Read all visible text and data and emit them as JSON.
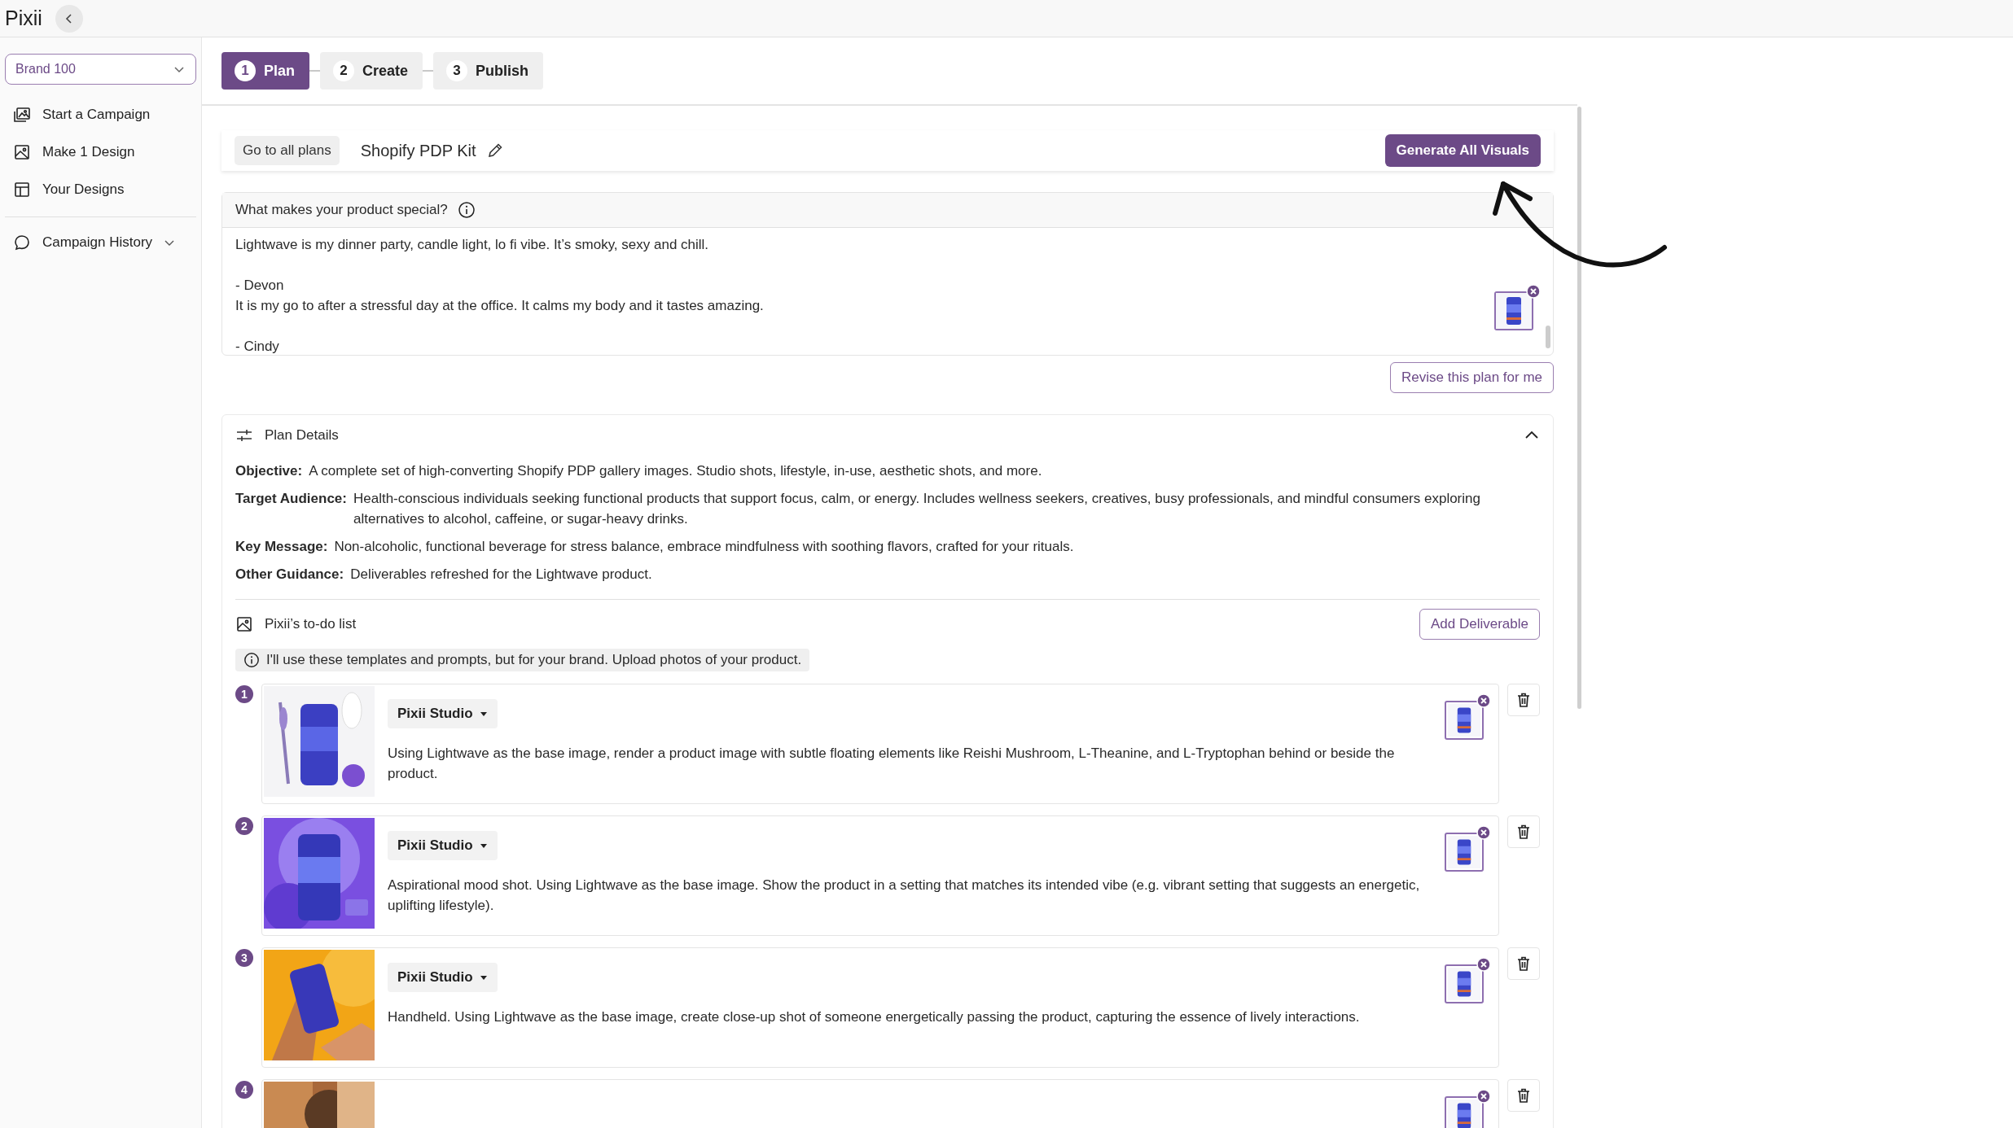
{
  "app": {
    "logo": "Pixii"
  },
  "sidebar": {
    "brand_select": "Brand 100",
    "items": [
      {
        "label": "Start a Campaign",
        "kind": "campaign"
      },
      {
        "label": "Make 1 Design",
        "kind": "design"
      },
      {
        "label": "Your Designs",
        "kind": "designs"
      }
    ],
    "history": {
      "label": "Campaign History",
      "expanded": false
    }
  },
  "steps": [
    {
      "number": "1",
      "label": "Plan",
      "selected": true
    },
    {
      "number": "2",
      "label": "Create",
      "selected": false
    },
    {
      "number": "3",
      "label": "Publish",
      "selected": false
    }
  ],
  "header": {
    "back_button": "Go to all plans",
    "title": "Shopify PDP Kit",
    "primary_button": "Generate All Visuals"
  },
  "special": {
    "label": "What makes your product special?",
    "lines": [
      {
        "text": "Lightwave is my dinner party, candle light, lo fi vibe. It’s smoky, sexy and chill.",
        "kind": "quote"
      },
      {
        "text": "- Devon",
        "kind": "author"
      },
      {
        "text": "It is my go to after a stressful day at the office. It calms my body and it tastes amazing.",
        "kind": "quote"
      },
      {
        "text": "- Cindy",
        "kind": "author"
      }
    ],
    "revise_button": "Revise this plan for me"
  },
  "plan_details": {
    "title": "Plan Details",
    "expanded": true,
    "fields": [
      {
        "label": "Objective:",
        "value": "A complete set of high-converting Shopify PDP gallery images. Studio shots, lifestyle, in-use, aesthetic shots, and more."
      },
      {
        "label": "Target Audience:",
        "value": "Health-conscious individuals seeking functional products that support focus, calm, or energy. Includes wellness seekers, creatives, busy professionals, and mindful consumers exploring alternatives to alcohol, caffeine, or sugar-heavy drinks."
      },
      {
        "label": "Key Message:",
        "value": "Non-alcoholic, functional beverage for stress balance, embrace mindfulness with soothing flavors, crafted for your rituals."
      },
      {
        "label": "Other Guidance:",
        "value": "Deliverables refreshed for the Lightwave product."
      }
    ]
  },
  "todo": {
    "title": "Pixii’s to-do list",
    "add_button": "Add Deliverable",
    "note": "I'll use these templates and prompts, but for your brand. Upload photos of your product.",
    "items": [
      {
        "number": "1",
        "template": "Pixii Studio",
        "description": "Using Lightwave as the base image, render a product image with subtle floating elements like Reishi Mushroom, L-Theanine, and L-Tryptophan behind or beside the product."
      },
      {
        "number": "2",
        "template": "Pixii Studio",
        "description": "Aspirational mood shot. Using Lightwave as the base image. Show the product in a setting that matches its intended vibe (e.g. vibrant setting that suggests an energetic, uplifting lifestyle)."
      },
      {
        "number": "3",
        "template": "Pixii Studio",
        "description": "Handheld. Using Lightwave as the base image, create close-up shot of someone energetically passing the product, capturing the essence of lively interactions."
      },
      {
        "number": "4"
      }
    ]
  }
}
